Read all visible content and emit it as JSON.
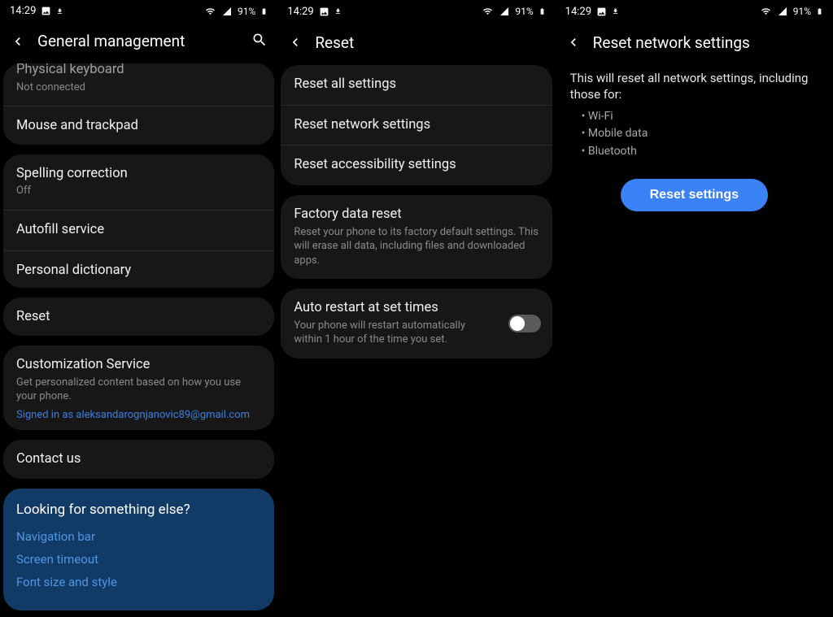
{
  "status": {
    "time": "14:29",
    "battery": "91%"
  },
  "s1": {
    "header": {
      "title": "General management"
    },
    "group1": {
      "physical_keyboard_title": "Physical keyboard",
      "physical_keyboard_sub": "Not connected",
      "mouse_trackpad": "Mouse and trackpad"
    },
    "group2": {
      "spelling_title": "Spelling correction",
      "spelling_sub": "Off",
      "autofill": "Autofill service",
      "dictionary": "Personal dictionary"
    },
    "group3": {
      "reset": "Reset"
    },
    "group4": {
      "cust_title": "Customization Service",
      "cust_sub": "Get personalized content based on how you use your phone.",
      "cust_link": "Signed in as aleksandarognjanovic89@gmail.com"
    },
    "group5": {
      "contact": "Contact us"
    },
    "lookup": {
      "heading": "Looking for something else?",
      "nav": "Navigation bar",
      "timeout": "Screen timeout",
      "font": "Font size and style"
    }
  },
  "s2": {
    "header": {
      "title": "Reset"
    },
    "g1": {
      "all": "Reset all settings",
      "net": "Reset network settings",
      "acc": "Reset accessibility settings"
    },
    "g2": {
      "factory_title": "Factory data reset",
      "factory_sub": "Reset your phone to its factory default settings. This will erase all data, including files and downloaded apps."
    },
    "g3": {
      "auto_title": "Auto restart at set times",
      "auto_sub": "Your phone will restart automatically within 1 hour of the time you set."
    }
  },
  "s3": {
    "header": {
      "title": "Reset network settings"
    },
    "lead": "This will reset all network settings, including those for:",
    "items": {
      "wifi": "Wi-Fi",
      "mobile": "Mobile data",
      "bt": "Bluetooth"
    },
    "button": "Reset settings"
  }
}
